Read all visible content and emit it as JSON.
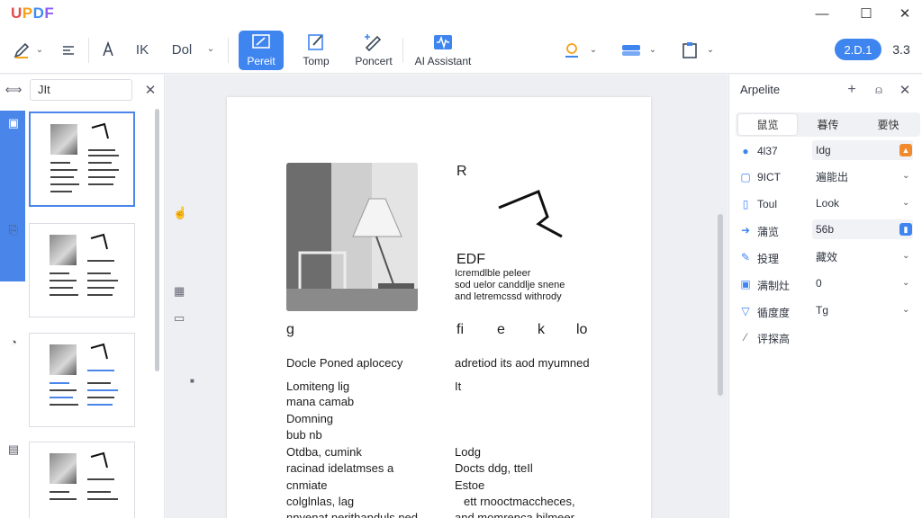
{
  "app": {
    "logo": {
      "u": "U",
      "p": "P",
      "d": "D",
      "f": "F"
    },
    "window_controls": {
      "minimize": "—",
      "maximize": "☐",
      "close": "✕"
    }
  },
  "toolbar": {
    "font_label_1": "IK",
    "font_label_2": "Dol",
    "buttons": [
      {
        "label": "Pereit"
      },
      {
        "label": "Tomp"
      },
      {
        "label": "Poncert"
      },
      {
        "label": "AI Assistant"
      }
    ],
    "version_badge": "2.D.1",
    "version_text": "3.3",
    "accent": "#3f85f0"
  },
  "left_panel": {
    "search_value": "JIt"
  },
  "page": {
    "header_letter": "R",
    "heading": "EDF",
    "intro_lines": [
      "Icremdlble peleer",
      "sod uelor canddlje snene",
      "and letremcssd withrody"
    ],
    "row_letters": [
      "g",
      "fi",
      "e",
      "k",
      "lo"
    ],
    "left_col_title": "Docle Poned aplocecy",
    "left_col_lines": [
      "Lomiteng lig",
      "mana camab",
      "Domning",
      "bub nb",
      "Otdba, cumink",
      "racinad idelatmses a",
      "cnmiate",
      "colglnlas, lag",
      "nnyenat nerithanduls ned"
    ],
    "right_col_title": "adretiod its aod myumned",
    "right_col_lt": "It",
    "right_col_heading": "Lodg",
    "right_col_lines": [
      "Docts ddg, tteIl",
      "Estoe",
      "ett rnooctmaccheces,",
      "and momrenca bilmeer"
    ]
  },
  "right_panel": {
    "title": "Arpelite",
    "tabs": [
      "鼠览",
      "暮传",
      "要快"
    ],
    "properties": [
      {
        "icon": "pin-icon",
        "label": "4l37",
        "value": "Idg"
      },
      {
        "icon": "doc-icon",
        "label": "9ICT",
        "value": "遍能出"
      },
      {
        "icon": "page-icon",
        "label": "Toul",
        "value": "Look"
      },
      {
        "icon": "arrow-icon",
        "label": "蒲览",
        "value": "56b"
      },
      {
        "icon": "edit-icon",
        "label": "投理",
        "value": "藏效"
      },
      {
        "icon": "image-icon",
        "label": "满制灶",
        "value": "0"
      },
      {
        "icon": "filter-icon",
        "label": "循度度",
        "value": "Tg"
      },
      {
        "icon": "pencil-icon",
        "label": "评探高",
        "value": ""
      }
    ]
  }
}
